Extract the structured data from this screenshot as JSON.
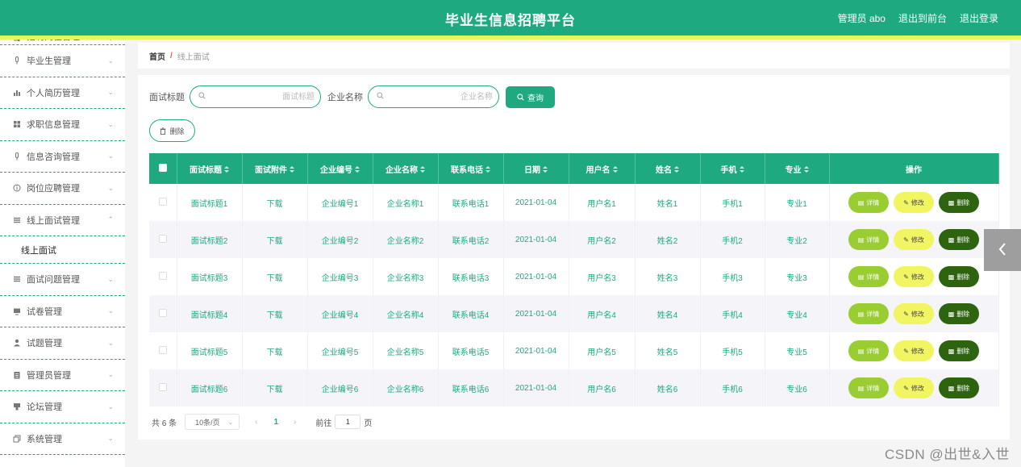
{
  "header": {
    "title": "毕业生信息招聘平台",
    "admin_label": "管理员 abo",
    "exit_front": "退出到前台",
    "logout": "退出登录"
  },
  "sidebar": {
    "items": [
      {
        "label": "招聘岗位管理",
        "icon": "sliders-icon"
      },
      {
        "label": "毕业生管理",
        "icon": "microphone-icon"
      },
      {
        "label": "个人简历管理",
        "icon": "bar-chart-icon"
      },
      {
        "label": "求职信息管理",
        "icon": "grid-icon"
      },
      {
        "label": "信息咨询管理",
        "icon": "microphone-icon"
      },
      {
        "label": "岗位应聘管理",
        "icon": "info-icon"
      },
      {
        "label": "线上面试管理",
        "icon": "list-icon",
        "expanded": true
      },
      {
        "label": "面试问题管理",
        "icon": "list-icon"
      },
      {
        "label": "试卷管理",
        "icon": "monitor-icon"
      },
      {
        "label": "试题管理",
        "icon": "user-icon"
      },
      {
        "label": "管理员管理",
        "icon": "document-icon"
      },
      {
        "label": "论坛管理",
        "icon": "forum-icon"
      },
      {
        "label": "系统管理",
        "icon": "copy-icon"
      }
    ],
    "submenu_active": "线上面试"
  },
  "breadcrumb": {
    "home": "首页",
    "separator": "/",
    "current": "线上面试"
  },
  "search": {
    "title_label": "面试标题",
    "title_placeholder": "面试标题",
    "company_label": "企业名称",
    "company_placeholder": "企业名称",
    "query_button": "查询",
    "delete_button": "删除"
  },
  "table": {
    "headers": [
      "面试标题",
      "面试附件",
      "企业编号",
      "企业名称",
      "联系电话",
      "日期",
      "用户名",
      "姓名",
      "手机",
      "专业",
      "操作"
    ],
    "rows": [
      [
        "面试标题1",
        "下载",
        "企业编号1",
        "企业名称1",
        "联系电话1",
        "2021-01-04",
        "用户名1",
        "姓名1",
        "手机1",
        "专业1"
      ],
      [
        "面试标题2",
        "下载",
        "企业编号2",
        "企业名称2",
        "联系电话2",
        "2021-01-04",
        "用户名2",
        "姓名2",
        "手机2",
        "专业2"
      ],
      [
        "面试标题3",
        "下载",
        "企业编号3",
        "企业名称3",
        "联系电话3",
        "2021-01-04",
        "用户名3",
        "姓名3",
        "手机3",
        "专业3"
      ],
      [
        "面试标题4",
        "下载",
        "企业编号4",
        "企业名称4",
        "联系电话4",
        "2021-01-04",
        "用户名4",
        "姓名4",
        "手机4",
        "专业4"
      ],
      [
        "面试标题5",
        "下载",
        "企业编号5",
        "企业名称5",
        "联系电话5",
        "2021-01-04",
        "用户名5",
        "姓名5",
        "手机5",
        "专业5"
      ],
      [
        "面试标题6",
        "下载",
        "企业编号6",
        "企业名称6",
        "联系电话6",
        "2021-01-04",
        "用户名6",
        "姓名6",
        "手机6",
        "专业6"
      ]
    ],
    "actions": {
      "detail": "详情",
      "edit": "修改",
      "delete": "删除"
    }
  },
  "pagination": {
    "total": "共 6 条",
    "page_size": "10条/页",
    "current_page": "1",
    "goto_label": "前往",
    "goto_value": "1",
    "page_suffix": "页"
  },
  "watermark": "CSDN @出世&入世",
  "colors": {
    "primary": "#1ea981",
    "accent_stripe": "#e8f55a",
    "detail": "#9acd32",
    "edit": "#f2f562",
    "delete": "#2e6410"
  }
}
